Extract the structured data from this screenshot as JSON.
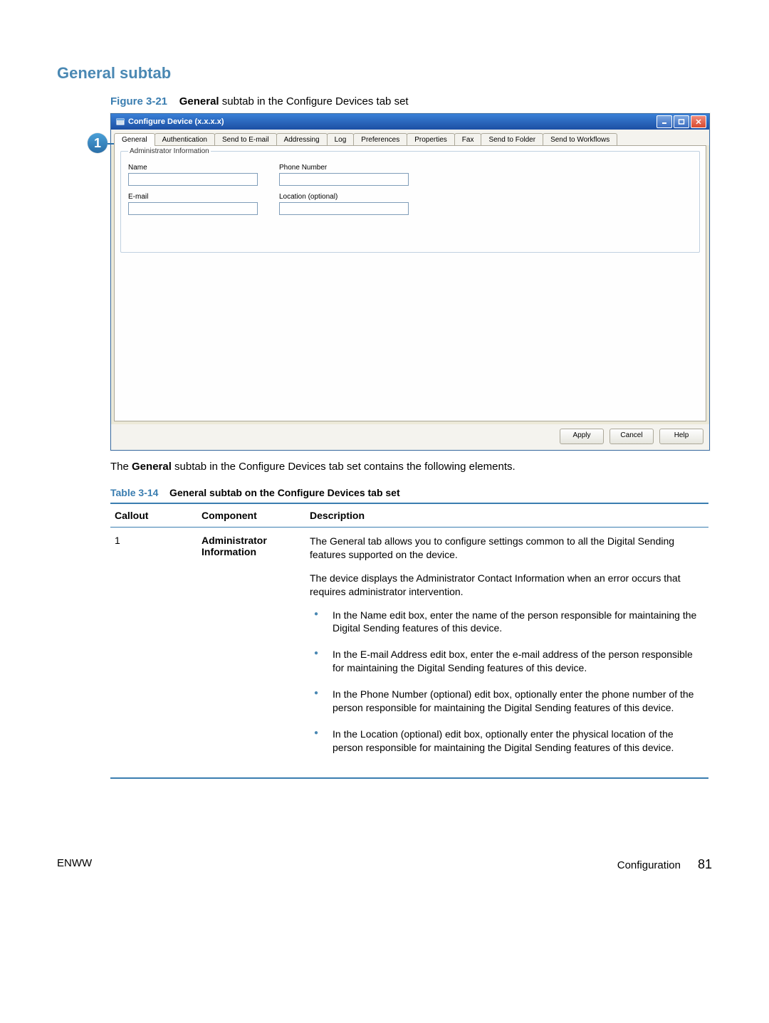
{
  "section_title": "General subtab",
  "figure": {
    "label": "Figure 3-21",
    "bold": "General",
    "rest": " subtab in the Configure Devices tab set"
  },
  "callout_number": "1",
  "window": {
    "title": "Configure Device (x.x.x.x)",
    "tabs": [
      "General",
      "Authentication",
      "Send to E-mail",
      "Addressing",
      "Log",
      "Preferences",
      "Properties",
      "Fax",
      "Send to Folder",
      "Send to Workflows"
    ],
    "active_tab_index": 0,
    "fieldset_legend": "Administrator Information",
    "fields": {
      "name_label": "Name",
      "phone_label": "Phone Number",
      "email_label": "E-mail",
      "location_label": "Location (optional)"
    },
    "buttons": {
      "apply": "Apply",
      "cancel": "Cancel",
      "help": "Help"
    }
  },
  "para_pre": "The ",
  "para_bold": "General",
  "para_post": " subtab in the Configure Devices tab set contains the following elements.",
  "table_caption": {
    "label": "Table 3-14",
    "bold": "General subtab on the Configure Devices tab set"
  },
  "table": {
    "headers": {
      "c1": "Callout",
      "c2": "Component",
      "c3": "Description"
    },
    "row": {
      "callout": "1",
      "component": "Administrator Information",
      "desc_p1": "The General tab allows you to configure settings common to all the Digital Sending features supported on the device.",
      "desc_p2": "The device displays the Administrator Contact Information when an error occurs that requires administrator intervention.",
      "bullets": [
        "In the Name edit box, enter the name of the person responsible for maintaining the Digital Sending features of this device.",
        "In the E-mail Address edit box, enter the e-mail address of the person responsible for maintaining the Digital Sending features of this device.",
        "In the Phone Number (optional) edit box, optionally enter the phone number of the person responsible for maintaining the Digital Sending features of this device.",
        "In the Location (optional) edit box, optionally enter the physical location of the person responsible for maintaining the Digital Sending features of this device."
      ]
    }
  },
  "footer": {
    "left": "ENWW",
    "section": "Configuration",
    "page": "81"
  }
}
